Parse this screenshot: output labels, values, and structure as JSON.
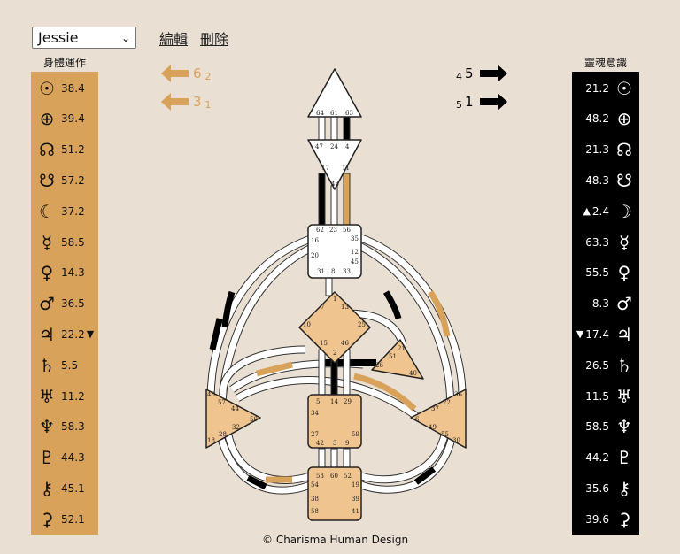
{
  "profile_select": {
    "value": "Jessie"
  },
  "toolbar": {
    "edit": "編輯",
    "delete": "刪除"
  },
  "design_column": {
    "title": "身體運作",
    "rows": [
      {
        "symbol": "☉",
        "value": "38.4",
        "marker": ""
      },
      {
        "symbol": "⊕",
        "value": "39.4",
        "marker": ""
      },
      {
        "symbol": "☊",
        "value": "51.2",
        "marker": ""
      },
      {
        "symbol": "☋",
        "value": "57.2",
        "marker": ""
      },
      {
        "symbol": "☾",
        "value": "37.2",
        "marker": ""
      },
      {
        "symbol": "☿",
        "value": "58.5",
        "marker": ""
      },
      {
        "symbol": "♀",
        "value": "14.3",
        "marker": ""
      },
      {
        "symbol": "♂",
        "value": "36.5",
        "marker": ""
      },
      {
        "symbol": "♃",
        "value": "22.2",
        "marker": "▼"
      },
      {
        "symbol": "♄",
        "value": "5.5",
        "marker": ""
      },
      {
        "symbol": "♅",
        "value": "11.2",
        "marker": ""
      },
      {
        "symbol": "♆",
        "value": "58.3",
        "marker": ""
      },
      {
        "symbol": "♇",
        "value": "44.3",
        "marker": ""
      },
      {
        "symbol": "⚷",
        "value": "45.1",
        "marker": ""
      },
      {
        "symbol": "⚳",
        "value": "52.1",
        "marker": ""
      }
    ]
  },
  "personality_column": {
    "title": "靈魂意識",
    "rows": [
      {
        "symbol": "☉",
        "value": "21.2",
        "marker": ""
      },
      {
        "symbol": "⊕",
        "value": "48.2",
        "marker": ""
      },
      {
        "symbol": "☊",
        "value": "21.3",
        "marker": ""
      },
      {
        "symbol": "☋",
        "value": "48.3",
        "marker": ""
      },
      {
        "symbol": "☽",
        "value": "2.4",
        "marker": "▲"
      },
      {
        "symbol": "☿",
        "value": "63.3",
        "marker": ""
      },
      {
        "symbol": "♀",
        "value": "55.5",
        "marker": ""
      },
      {
        "symbol": "♂",
        "value": "8.3",
        "marker": ""
      },
      {
        "symbol": "♃",
        "value": "17.4",
        "marker": "▼"
      },
      {
        "symbol": "♄",
        "value": "26.5",
        "marker": ""
      },
      {
        "symbol": "♅",
        "value": "11.5",
        "marker": ""
      },
      {
        "symbol": "♆",
        "value": "58.5",
        "marker": ""
      },
      {
        "symbol": "♇",
        "value": "44.2",
        "marker": ""
      },
      {
        "symbol": "⚷",
        "value": "35.6",
        "marker": ""
      },
      {
        "symbol": "⚳",
        "value": "39.6",
        "marker": ""
      }
    ]
  },
  "variables": {
    "left": [
      {
        "big": "6",
        "small": "2"
      },
      {
        "big": "3",
        "small": "1"
      }
    ],
    "right": [
      {
        "small": "4",
        "big": "5"
      },
      {
        "small": "5",
        "big": "1"
      }
    ]
  },
  "centers": {
    "head": [
      "64",
      "61",
      "63"
    ],
    "ajna": [
      "47",
      "24",
      "4",
      "17",
      "11",
      "43"
    ],
    "throat": [
      "62",
      "23",
      "56",
      "16",
      "35",
      "20",
      "12",
      "45",
      "31",
      "8",
      "33"
    ],
    "g": [
      "1",
      "13",
      "7",
      "10",
      "25",
      "15",
      "46",
      "2"
    ],
    "ego": [
      "21",
      "51",
      "26",
      "40"
    ],
    "spleen": [
      "48",
      "57",
      "44",
      "50",
      "32",
      "28",
      "18"
    ],
    "sacral": [
      "5",
      "14",
      "29",
      "34",
      "27",
      "59",
      "42",
      "3",
      "9"
    ],
    "solar": [
      "36",
      "22",
      "37",
      "6",
      "49",
      "55",
      "30"
    ],
    "root": [
      "53",
      "60",
      "52",
      "54",
      "19",
      "38",
      "39",
      "58",
      "41"
    ]
  },
  "colors": {
    "design": "#d8a25a",
    "personality": "#000000",
    "background": "#eadfd3"
  },
  "footer": "© Charisma Human Design"
}
